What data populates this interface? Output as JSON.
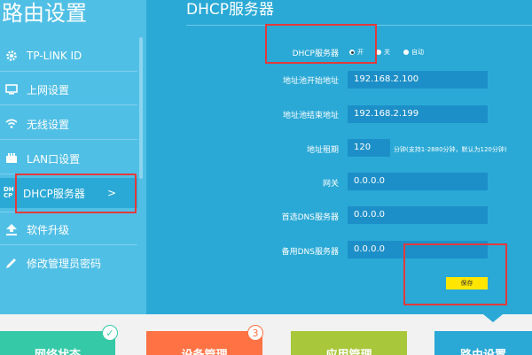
{
  "sidebar": {
    "title": "路由设置",
    "items": [
      {
        "label": "TP-LINK ID",
        "icon": "gear-icon"
      },
      {
        "label": "上网设置",
        "icon": "monitor-icon"
      },
      {
        "label": "无线设置",
        "icon": "wifi-icon"
      },
      {
        "label": "LAN口设置",
        "icon": "lan-icon"
      },
      {
        "label": "DHCP服务器",
        "icon": "dhcp-icon",
        "icon_text": "DH CP",
        "arrow": ">"
      },
      {
        "label": "软件升级",
        "icon": "upload-icon"
      },
      {
        "label": "修改管理员密码",
        "icon": "pencil-icon"
      }
    ]
  },
  "main": {
    "title": "DHCP服务器",
    "dhcp_label": "DHCP服务器",
    "radio": {
      "on": "开",
      "off": "关",
      "auto": "自动",
      "selected": "on"
    },
    "fields": {
      "start_label": "地址池开始地址",
      "start_value": "192.168.2.100",
      "end_label": "地址池结束地址",
      "end_value": "192.168.2.199",
      "lease_label": "地址租期",
      "lease_value": "120",
      "lease_hint": "分钟(支持1-2880分钟，默认为120分钟)",
      "gateway_label": "网关",
      "gateway_value": "0.0.0.0",
      "dns1_label": "首选DNS服务器",
      "dns1_value": "0.0.0.0",
      "dns2_label": "备用DNS服务器",
      "dns2_value": "0.0.0.0"
    },
    "save_label": "保存"
  },
  "bottom_tabs": [
    {
      "label": "网络状态",
      "color": "#35c9a7",
      "badge": "✓"
    },
    {
      "label": "设备管理",
      "color": "#ff7243",
      "badge": "3"
    },
    {
      "label": "应用管理",
      "color": "#a9c73b"
    },
    {
      "label": "路由设置",
      "color": "#2aa9d6"
    }
  ],
  "colors": {
    "accent": "#2aa9d6",
    "sidebar": "#50bfe6",
    "highlight": "#e23a3a",
    "save": "#ffe600"
  }
}
